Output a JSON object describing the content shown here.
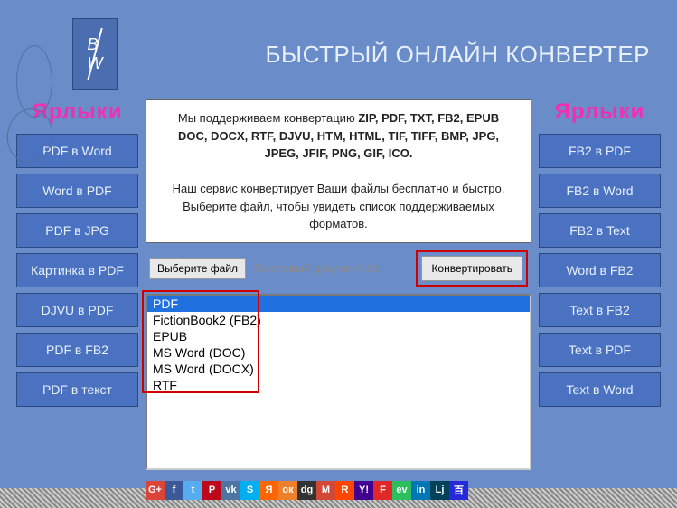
{
  "header": {
    "logo_b": "B",
    "logo_w": "W",
    "title": "БЫСТРЫЙ ОНЛАЙН КОНВЕРТЕР"
  },
  "info": {
    "line1_pre": "Мы поддерживаем конвертацию ",
    "line1_bold": "ZIP, PDF, TXT, FB2, EPUB DOC, DOCX, RTF, DJVU, HTM, HTML, TIF, TIFF, BMP, JPG, JPEG, JFIF, PNG, GIF, ICO.",
    "line2": "Наш сервис конвертирует Ваши файлы бесплатно и быстро. Выберите файл, чтобы увидеть список поддерживаемых форматов."
  },
  "sidebar_left": {
    "title": "Ярлыки",
    "items": [
      "PDF в Word",
      "Word в PDF",
      "PDF в JPG",
      "Картинка в PDF",
      "DJVU в PDF",
      "PDF в FB2",
      "PDF в текст"
    ]
  },
  "sidebar_right": {
    "title": "Ярлыки",
    "items": [
      "FB2 в PDF",
      "FB2 в Word",
      "FB2 в Text",
      "Word в FB2",
      "Text в FB2",
      "Text в PDF",
      "Text в Word"
    ]
  },
  "file": {
    "button": "Выберите файл",
    "name": "Текстовый документ.txt",
    "convert": "Конвертировать"
  },
  "formats": [
    "PDF",
    "FictionBook2 (FB2)",
    "EPUB",
    "MS Word (DOC)",
    "MS Word (DOCX)",
    "RTF"
  ],
  "social": [
    {
      "label": "G+",
      "bg": "#db4437"
    },
    {
      "label": "f",
      "bg": "#3b5998"
    },
    {
      "label": "t",
      "bg": "#55acee"
    },
    {
      "label": "P",
      "bg": "#bd081c"
    },
    {
      "label": "vk",
      "bg": "#4c75a3"
    },
    {
      "label": "S",
      "bg": "#00aff0"
    },
    {
      "label": "Я",
      "bg": "#ff6600"
    },
    {
      "label": "ок",
      "bg": "#ed812b"
    },
    {
      "label": "dg",
      "bg": "#333"
    },
    {
      "label": "M",
      "bg": "#d14836"
    },
    {
      "label": "R",
      "bg": "#ff4500"
    },
    {
      "label": "Y!",
      "bg": "#400191"
    },
    {
      "label": "F",
      "bg": "#e12828"
    },
    {
      "label": "ev",
      "bg": "#2dbe60"
    },
    {
      "label": "in",
      "bg": "#0077b5"
    },
    {
      "label": "Lj",
      "bg": "#004359"
    },
    {
      "label": "百",
      "bg": "#2529d8"
    }
  ]
}
